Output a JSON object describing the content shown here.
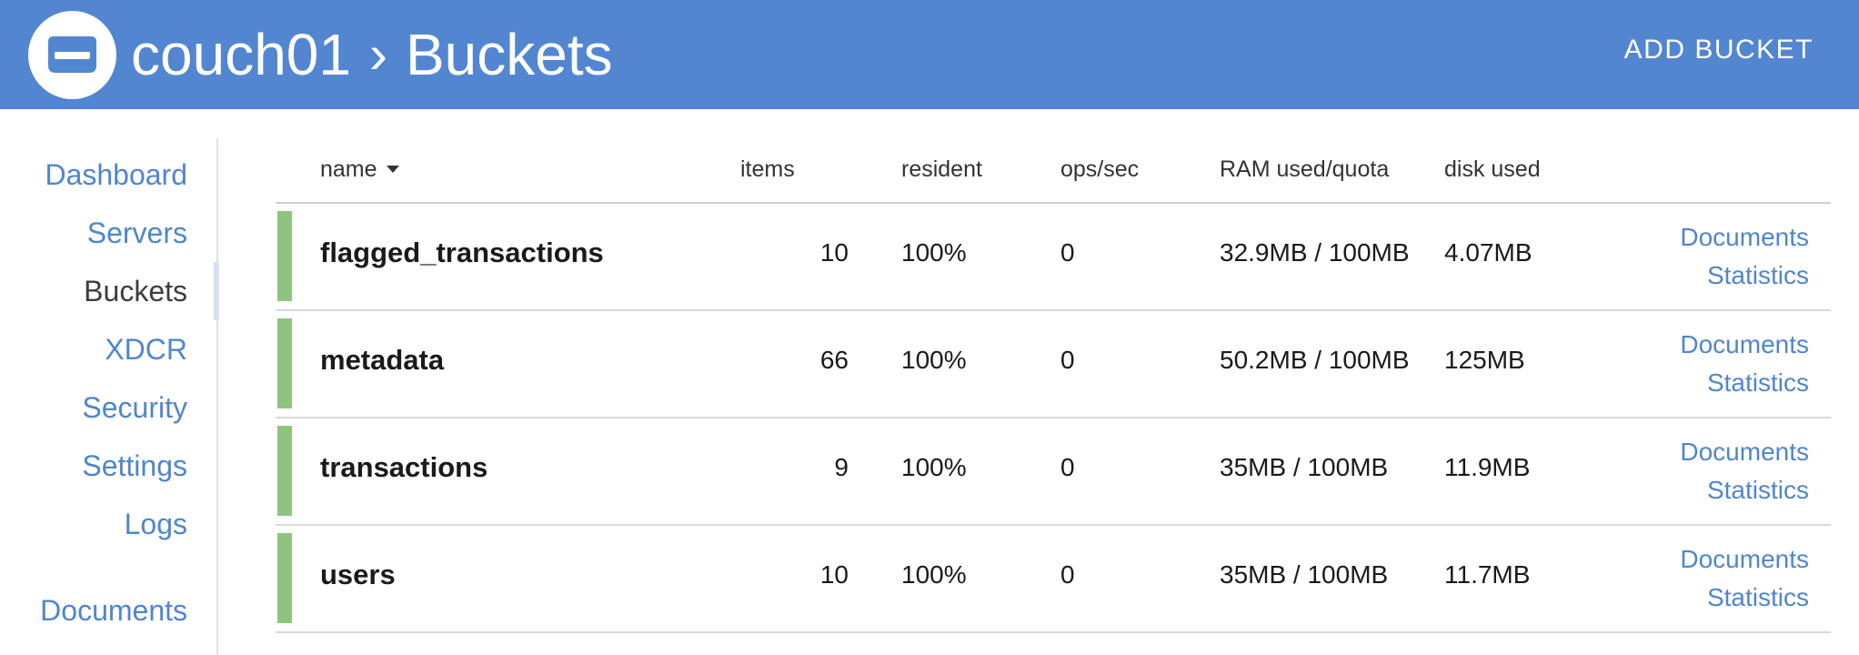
{
  "header": {
    "cluster_name": "couch01",
    "separator": "›",
    "page_title": "Buckets",
    "add_bucket_label": "ADD BUCKET",
    "logo_icon": "couchbase-logo-icon",
    "background_color": "#5286d1"
  },
  "sidebar": {
    "items": [
      {
        "label": "Dashboard",
        "active": false
      },
      {
        "label": "Servers",
        "active": false
      },
      {
        "label": "Buckets",
        "active": true
      },
      {
        "label": "XDCR",
        "active": false
      },
      {
        "label": "Security",
        "active": false
      },
      {
        "label": "Settings",
        "active": false
      },
      {
        "label": "Logs",
        "active": false
      },
      {
        "label": "Documents",
        "active": false
      }
    ],
    "link_color": "#4f86ce"
  },
  "table": {
    "columns": {
      "name": "name",
      "items": "items",
      "resident": "resident",
      "ops": "ops/sec",
      "ram": "RAM used/quota",
      "disk": "disk used"
    },
    "sort_icon": "caret-down-icon",
    "status_color": "#8fc47f",
    "rows": [
      {
        "name": "flagged_transactions",
        "items": "10",
        "resident": "100%",
        "ops": "0",
        "ram": "32.9MB / 100MB",
        "disk": "4.07MB",
        "documents_label": "Documents",
        "statistics_label": "Statistics"
      },
      {
        "name": "metadata",
        "items": "66",
        "resident": "100%",
        "ops": "0",
        "ram": "50.2MB / 100MB",
        "disk": "125MB",
        "documents_label": "Documents",
        "statistics_label": "Statistics"
      },
      {
        "name": "transactions",
        "items": "9",
        "resident": "100%",
        "ops": "0",
        "ram": "35MB / 100MB",
        "disk": "11.9MB",
        "documents_label": "Documents",
        "statistics_label": "Statistics"
      },
      {
        "name": "users",
        "items": "10",
        "resident": "100%",
        "ops": "0",
        "ram": "35MB / 100MB",
        "disk": "11.7MB",
        "documents_label": "Documents",
        "statistics_label": "Statistics"
      }
    ]
  }
}
